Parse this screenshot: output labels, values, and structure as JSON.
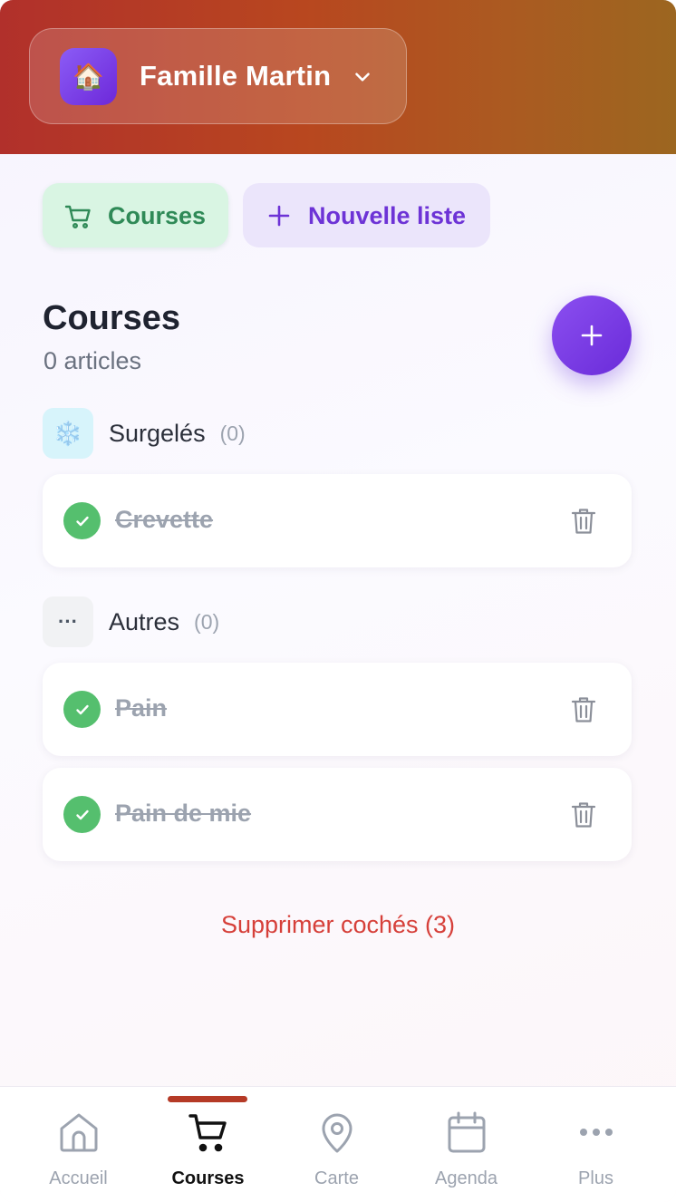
{
  "header": {
    "family_emoji": "🏠",
    "family_name": "Famille Martin"
  },
  "chips": {
    "courses_label": "Courses",
    "new_list_label": "Nouvelle liste"
  },
  "list": {
    "title": "Courses",
    "count": "0 articles"
  },
  "categories": [
    {
      "emoji": "❄️",
      "name": "Surgelés",
      "count": "(0)",
      "items": [
        {
          "label": "Crevette",
          "checked": true
        }
      ]
    },
    {
      "emoji": "···",
      "name": "Autres",
      "count": "(0)",
      "items": [
        {
          "label": "Pain",
          "checked": true
        },
        {
          "label": "Pain de mie",
          "checked": true
        }
      ]
    }
  ],
  "actions": {
    "delete_checked": "Supprimer cochés (3)"
  },
  "nav": [
    {
      "label": "Accueil",
      "icon": "home-icon",
      "active": false
    },
    {
      "label": "Courses",
      "icon": "cart-icon",
      "active": true
    },
    {
      "label": "Carte",
      "icon": "map-pin-icon",
      "active": false
    },
    {
      "label": "Agenda",
      "icon": "calendar-icon",
      "active": false
    },
    {
      "label": "Plus",
      "icon": "more-icon",
      "active": false
    }
  ],
  "colors": {
    "header_gradient_start": "#b1302b",
    "header_gradient_end": "#9c6620",
    "accent_purple": "#6d33d6",
    "success_green": "#55bf6e",
    "danger_red": "#d6403a"
  }
}
